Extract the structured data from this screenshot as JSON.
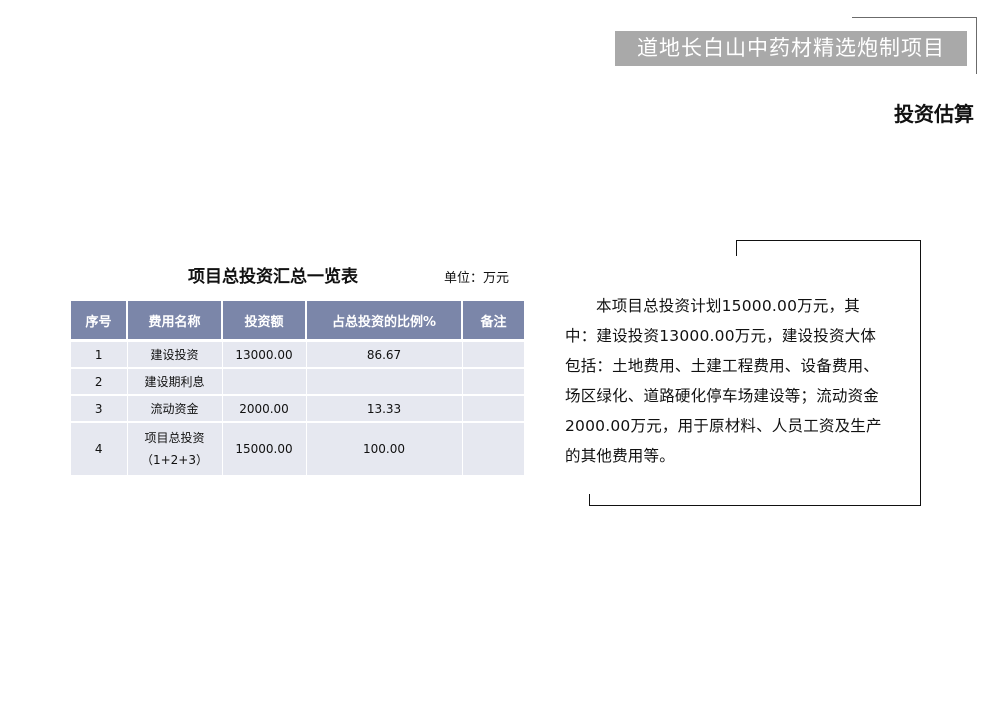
{
  "header": {
    "project_title": "道地长白山中药材精选炮制项目",
    "section_title": "投资估算"
  },
  "table": {
    "title": "项目总投资汇总一览表",
    "unit": "单位：万元",
    "columns": [
      "序号",
      "费用名称",
      "投资额",
      "占总投资的比例%",
      "备注"
    ],
    "rows": [
      {
        "no": "1",
        "name": "建设投资",
        "name2": "",
        "amount": "13000.00",
        "ratio": "86.67",
        "note": ""
      },
      {
        "no": "2",
        "name": "建设期利息",
        "name2": "",
        "amount": "",
        "ratio": "",
        "note": ""
      },
      {
        "no": "3",
        "name": "流动资金",
        "name2": "",
        "amount": "2000.00",
        "ratio": "13.33",
        "note": ""
      },
      {
        "no": "4",
        "name": "项目总投资",
        "name2": "（1+2+3）",
        "amount": "15000.00",
        "ratio": "100.00",
        "note": ""
      }
    ]
  },
  "description": "本项目总投资计划15000.00万元，其中：建设投资13000.00万元，建设投资大体包括：土地费用、土建工程费用、设备费用、场区绿化、道路硬化停车场建设等；流动资金2000.00万元，用于原材料、人员工资及生产的其他费用等。",
  "colors": {
    "banner_bg": "#a9a9a9",
    "table_header_bg": "#7b86a9",
    "table_cell_bg": "#e6e8f0"
  }
}
